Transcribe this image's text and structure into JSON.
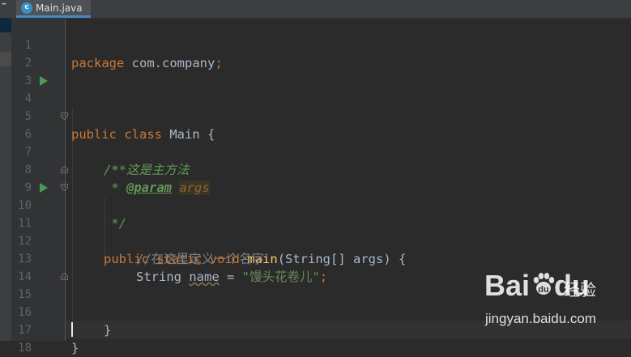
{
  "tab": {
    "icon": "c",
    "label": "Main.java"
  },
  "lines": [
    {
      "n": "1",
      "kw1": "package",
      "t1": " com.company",
      "p1": ";"
    },
    {
      "n": "2"
    },
    {
      "n": "3"
    },
    {
      "n": "4",
      "kw1": "public",
      "kw2": "class",
      "t1": " Main {"
    },
    {
      "n": "5"
    },
    {
      "n": "6",
      "c": "/**"
    },
    {
      "n": "7",
      "c": " * 这是主方法"
    },
    {
      "n": "8",
      "c": " * ",
      "tag": "@param",
      "tagval": "args"
    },
    {
      "n": "9",
      "c": " */"
    },
    {
      "n": "10",
      "kw1": "public",
      "kw2": "static",
      "kw3": "void",
      "fn": "main",
      "t1": "(String[] args) {"
    },
    {
      "n": "11"
    },
    {
      "n": "12",
      "lc": "//在这里定义一个名字"
    },
    {
      "n": "13",
      "type": "String",
      "var": "name",
      "eq": " = ",
      "str": "\"馒头花卷儿\"",
      "semi": ";"
    },
    {
      "n": "14"
    },
    {
      "n": "15",
      "t1": "}"
    },
    {
      "n": "16"
    },
    {
      "n": "17",
      "t1": "}"
    },
    {
      "n": "18"
    }
  ],
  "watermark": {
    "logo": "Bai",
    "logo2": "du",
    "jingyan": "经验",
    "url": "jingyan.baidu.com"
  }
}
